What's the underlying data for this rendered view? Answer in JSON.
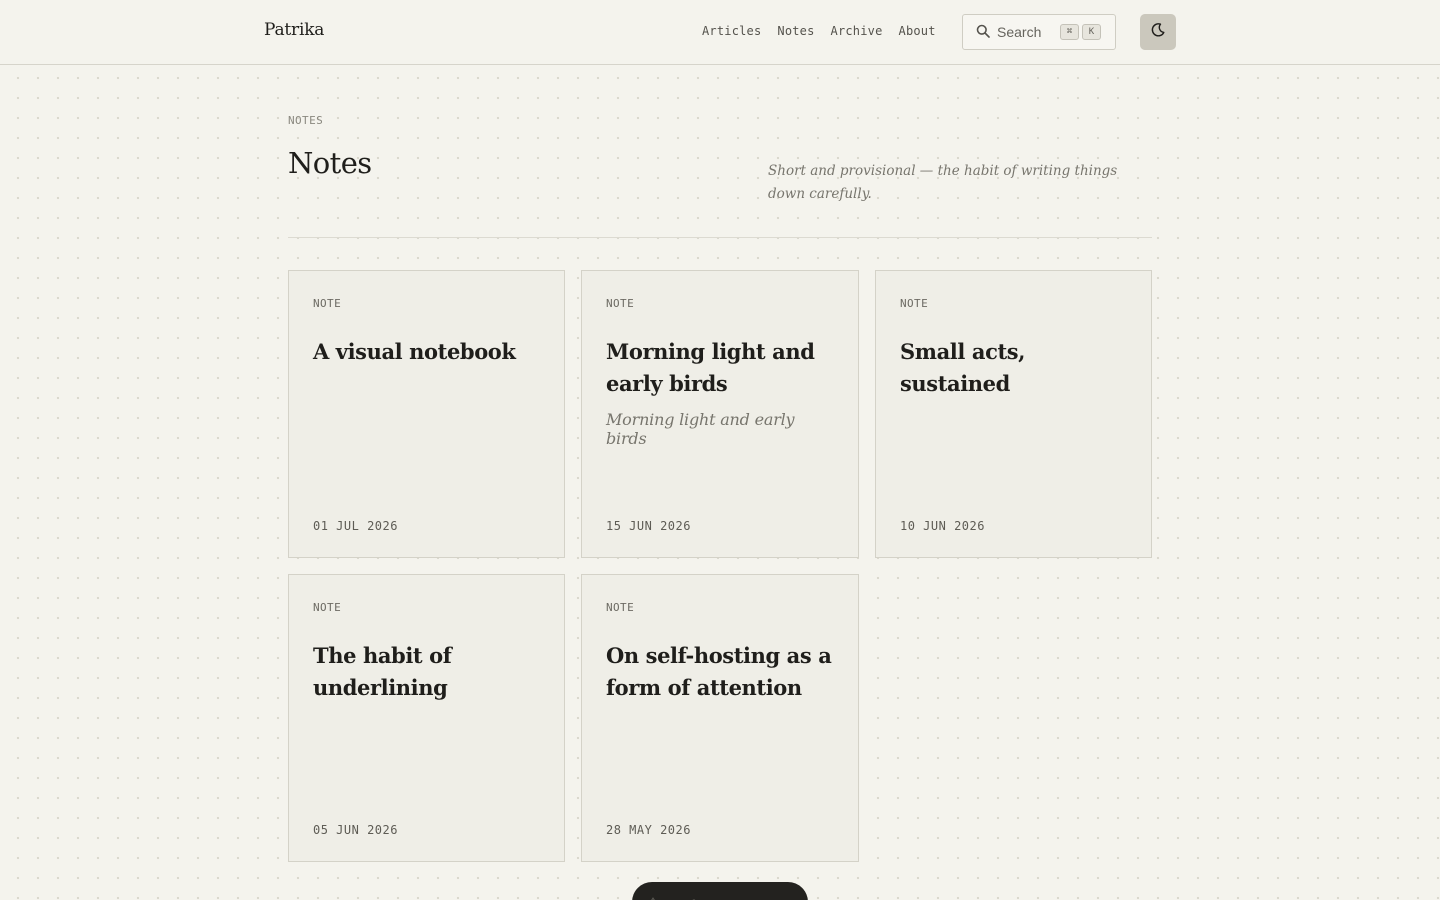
{
  "header": {
    "brand": "Patrika",
    "nav": [
      "Articles",
      "Notes",
      "Archive",
      "About"
    ],
    "search": {
      "label": "Search",
      "keys": [
        "⌘",
        "K"
      ]
    },
    "theme_toggle_icon": "moon-icon"
  },
  "page": {
    "eyebrow": "NOTES",
    "title": "Notes",
    "intro": "Short and provisional — the habit of writing things down carefully."
  },
  "cards": [
    {
      "kind": "NOTE",
      "title": "A visual notebook",
      "subtitle": "",
      "date": "01 JUL 2026"
    },
    {
      "kind": "NOTE",
      "title": "Morning light and early birds",
      "subtitle": "Morning light and early birds",
      "date": "15 JUN 2026"
    },
    {
      "kind": "NOTE",
      "title": "Small acts, sustained",
      "subtitle": "",
      "date": "10 JUN 2026"
    },
    {
      "kind": "NOTE",
      "title": "The habit of underlining",
      "subtitle": "",
      "date": "05 JUN 2026"
    },
    {
      "kind": "NOTE",
      "title": "On self-hosting as a form of attention",
      "subtitle": "",
      "date": "28 MAY 2026"
    }
  ],
  "dock": {
    "icons": [
      "pen-icon",
      "brush-icon",
      "menu-icon",
      "gear-icon"
    ]
  },
  "colors": {
    "background": "#f4f3ed",
    "card": "#efeee7",
    "accent_button": "#cbc8bd",
    "dock": "#23221f"
  }
}
